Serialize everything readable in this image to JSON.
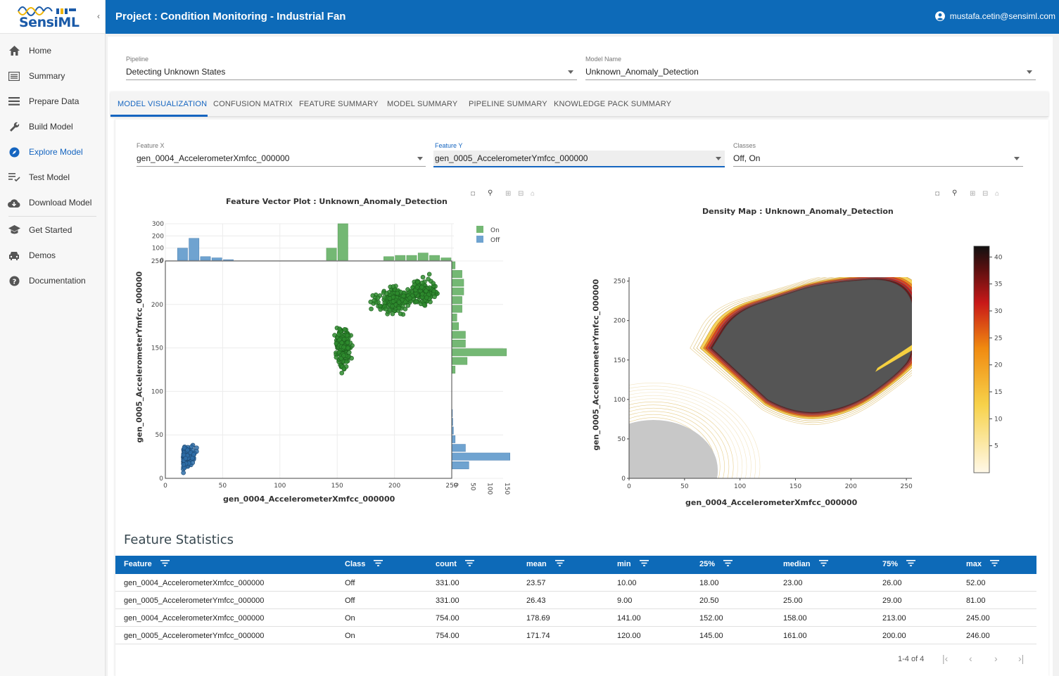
{
  "app": {
    "logo_text": "SensiML"
  },
  "sidebar": {
    "items": [
      {
        "label": "Home",
        "icon": "home-icon"
      },
      {
        "label": "Summary",
        "icon": "summary-icon"
      },
      {
        "label": "Prepare Data",
        "icon": "list-icon"
      },
      {
        "label": "Build Model",
        "icon": "wrench-icon"
      },
      {
        "label": "Explore Model",
        "icon": "compass-icon",
        "active": true
      },
      {
        "label": "Test Model",
        "icon": "checklist-icon"
      },
      {
        "label": "Download Model",
        "icon": "cloud-download-icon"
      },
      {
        "label": "Get Started",
        "icon": "school-icon"
      },
      {
        "label": "Demos",
        "icon": "car-icon"
      },
      {
        "label": "Documentation",
        "icon": "help-icon"
      }
    ]
  },
  "header": {
    "title": "Project : Condition Monitoring - Industrial Fan",
    "user": "mustafa.cetin@sensiml.com"
  },
  "selectors": {
    "pipeline_label": "Pipeline",
    "pipeline_value": "Detecting Unknown States",
    "model_label": "Model Name",
    "model_value": "Unknown_Anomaly_Detection"
  },
  "tabs": [
    "MODEL VISUALIZATION",
    "CONFUSION MATRIX",
    "FEATURE SUMMARY",
    "MODEL SUMMARY",
    "PIPELINE SUMMARY",
    "KNOWLEDGE PACK SUMMARY"
  ],
  "feature_controls": {
    "x_label": "Feature X",
    "x_value": "gen_0004_AccelerometerXmfcc_000000",
    "y_label": "Feature Y",
    "y_value": "gen_0005_AccelerometerYmfcc_000000",
    "classes_label": "Classes",
    "classes_value": "Off, On"
  },
  "colors": {
    "accent": "#0d6ab8",
    "on": "#2e8b2e",
    "off": "#2f6ea8",
    "on_bar": "#74b874",
    "off_bar": "#6fa3d0"
  },
  "chart_data": [
    {
      "type": "scatter",
      "title": "Feature Vector Plot : Unknown_Anomaly_Detection",
      "xlabel": "gen_0004_AccelerometerXmfcc_000000",
      "ylabel": "gen_0005_AccelerometerYmfcc_000000",
      "xlim": [
        0,
        250
      ],
      "ylim": [
        0,
        250
      ],
      "xticks": [
        "0",
        "50",
        "100",
        "150",
        "200",
        "250"
      ],
      "yticks": [
        "0",
        "50",
        "100",
        "150",
        "200",
        "250"
      ],
      "legend": [
        "On",
        "Off"
      ],
      "legend_position": "top-right",
      "series": [
        {
          "name": "On",
          "clusters": [
            {
              "cx": 155,
              "cy": 150,
              "sx": 4,
              "sy": 14,
              "n": 300
            },
            {
              "cx": 200,
              "cy": 205,
              "sx": 12,
              "sy": 10,
              "n": 220
            },
            {
              "cx": 225,
              "cy": 215,
              "sx": 7,
              "sy": 10,
              "n": 200
            }
          ]
        },
        {
          "name": "Off",
          "clusters": [
            {
              "cx": 23.57,
              "cy": 26.43,
              "sx": 8,
              "sy": 10,
              "n": 331
            }
          ]
        }
      ],
      "top_histogram": {
        "yticks": [
          "0",
          "100",
          "200",
          "300"
        ],
        "ylim": [
          0,
          300
        ],
        "on": [
          {
            "x": 145,
            "v": 100
          },
          {
            "x": 155,
            "v": 300
          },
          {
            "x": 195,
            "v": 30
          },
          {
            "x": 205,
            "v": 40
          },
          {
            "x": 215,
            "v": 40
          },
          {
            "x": 225,
            "v": 60
          },
          {
            "x": 235,
            "v": 40
          },
          {
            "x": 245,
            "v": 20
          }
        ],
        "off": [
          {
            "x": 15,
            "v": 100
          },
          {
            "x": 25,
            "v": 180
          },
          {
            "x": 35,
            "v": 30
          },
          {
            "x": 45,
            "v": 20
          },
          {
            "x": 55,
            "v": 5
          }
        ]
      },
      "right_histogram": {
        "xticks": [
          "0",
          "50",
          "100",
          "150"
        ],
        "xlim": [
          0,
          150
        ],
        "on": [
          {
            "y": 125,
            "v": 10
          },
          {
            "y": 135,
            "v": 45
          },
          {
            "y": 145,
            "v": 160
          },
          {
            "y": 155,
            "v": 40
          },
          {
            "y": 165,
            "v": 40
          },
          {
            "y": 175,
            "v": 20
          },
          {
            "y": 185,
            "v": 15
          },
          {
            "y": 195,
            "v": 30
          },
          {
            "y": 205,
            "v": 30
          },
          {
            "y": 215,
            "v": 35
          },
          {
            "y": 225,
            "v": 35
          },
          {
            "y": 235,
            "v": 30
          },
          {
            "y": 245,
            "v": 10
          }
        ],
        "off": [
          {
            "y": 15,
            "v": 50
          },
          {
            "y": 25,
            "v": 170
          },
          {
            "y": 35,
            "v": 40
          },
          {
            "y": 45,
            "v": 10
          },
          {
            "y": 55,
            "v": 5
          },
          {
            "y": 65,
            "v": 3
          },
          {
            "y": 75,
            "v": 2
          }
        ]
      }
    },
    {
      "type": "heatmap",
      "title": "Density Map : Unknown_Anomaly_Detection",
      "xlabel": "gen_0004_AccelerometerXmfcc_000000",
      "ylabel": "gen_0005_AccelerometerYmfcc_000000",
      "xlim": [
        0,
        255
      ],
      "ylim": [
        0,
        255
      ],
      "xticks": [
        "0",
        "50",
        "100",
        "150",
        "200",
        "250"
      ],
      "yticks": [
        "0",
        "50",
        "100",
        "150",
        "200",
        "250"
      ],
      "colorbar_ticks": [
        "5",
        "10",
        "15",
        "20",
        "25",
        "30",
        "35",
        "40"
      ],
      "colorbar_range": [
        0,
        42
      ]
    }
  ],
  "stats": {
    "title": "Feature Statistics",
    "columns": [
      "Feature",
      "Class",
      "count",
      "mean",
      "min",
      "25%",
      "median",
      "75%",
      "max"
    ],
    "rows": [
      [
        "gen_0004_AccelerometerXmfcc_000000",
        "Off",
        "331.00",
        "23.57",
        "10.00",
        "18.00",
        "23.00",
        "26.00",
        "52.00"
      ],
      [
        "gen_0005_AccelerometerYmfcc_000000",
        "Off",
        "331.00",
        "26.43",
        "9.00",
        "20.50",
        "25.00",
        "29.00",
        "81.00"
      ],
      [
        "gen_0004_AccelerometerXmfcc_000000",
        "On",
        "754.00",
        "178.69",
        "141.00",
        "152.00",
        "158.00",
        "213.00",
        "245.00"
      ],
      [
        "gen_0005_AccelerometerYmfcc_000000",
        "On",
        "754.00",
        "171.74",
        "120.00",
        "145.00",
        "161.00",
        "200.00",
        "246.00"
      ]
    ],
    "pagination": "1-4 of 4"
  }
}
